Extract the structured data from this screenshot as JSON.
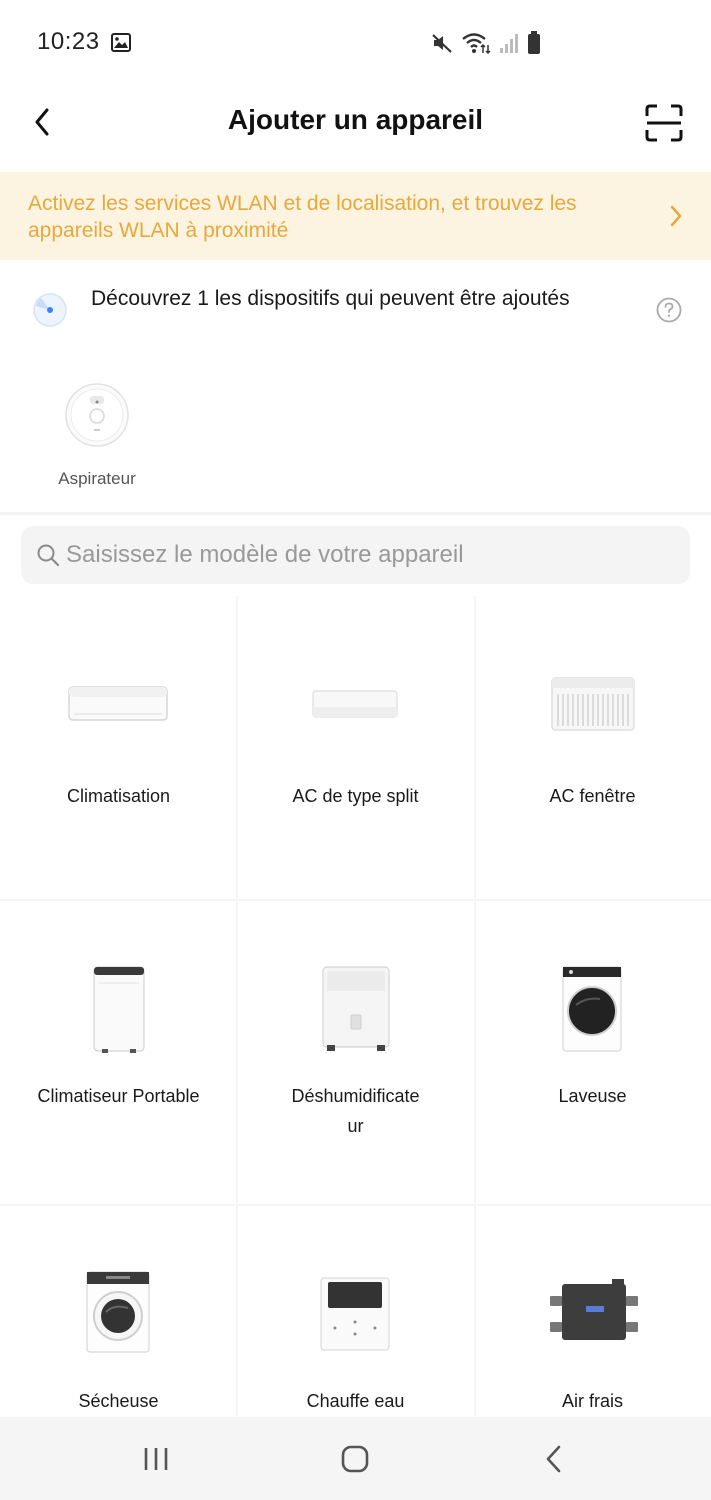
{
  "status_bar": {
    "time": "10:23"
  },
  "header": {
    "title": "Ajouter un appareil",
    "back_icon": "chevron-left-icon",
    "scan_icon": "scan-icon"
  },
  "banner": {
    "text": "Activez les services WLAN et de localisation, et trouvez les appareils WLAN à proximité",
    "color": "#e7a93b",
    "background": "#fdf3e1"
  },
  "discovery": {
    "text": "Découvrez 1 les dispositifs qui peuvent être ajoutés",
    "devices": [
      {
        "label": "Aspirateur",
        "icon": "robot-vacuum-icon"
      }
    ]
  },
  "search": {
    "placeholder": "Saisissez le modèle de votre appareil",
    "value": ""
  },
  "categories": [
    {
      "label": "Climatisation",
      "icon": "air-conditioner-icon"
    },
    {
      "label": "AC de type split",
      "icon": "split-ac-icon"
    },
    {
      "label": "AC fenêtre",
      "icon": "window-ac-icon"
    },
    {
      "label": "Climatiseur Portable",
      "icon": "portable-ac-icon"
    },
    {
      "label": "Déshumidificateur",
      "label_line1": "Déshumidificate",
      "label_line2": "ur",
      "icon": "dehumidifier-icon"
    },
    {
      "label": "Laveuse",
      "icon": "washer-icon"
    },
    {
      "label": "Sécheuse",
      "icon": "dryer-icon"
    },
    {
      "label": "Chauffe eau",
      "icon": "water-heater-icon"
    },
    {
      "label": "Air frais",
      "icon": "fresh-air-icon"
    }
  ],
  "navbar": {
    "recent_icon": "recent-apps-icon",
    "home_icon": "home-icon",
    "back_icon": "back-icon"
  }
}
